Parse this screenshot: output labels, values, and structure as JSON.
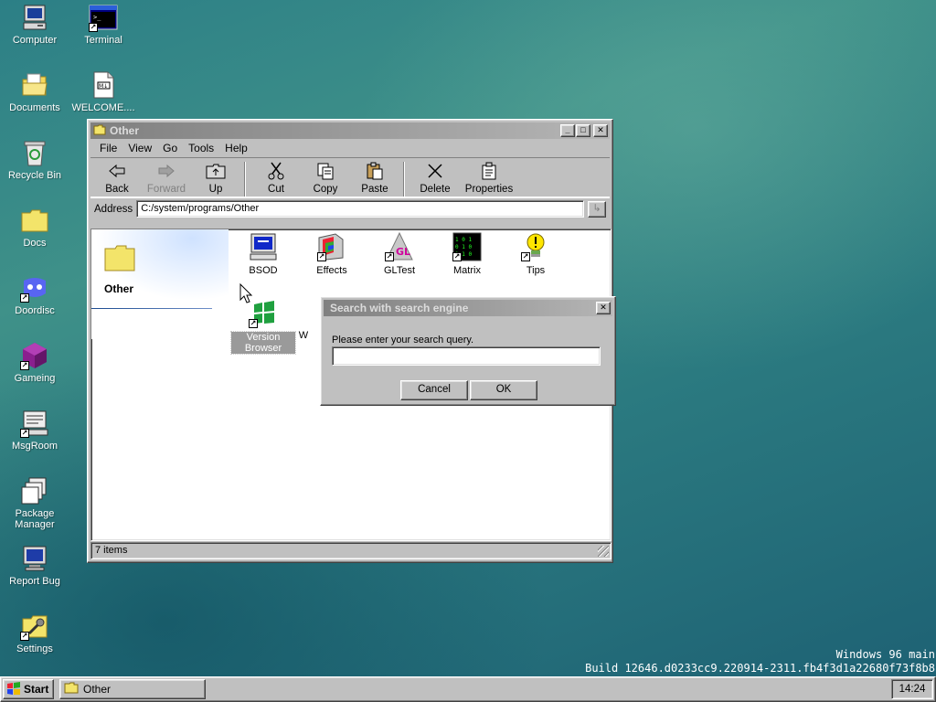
{
  "desktop_icons": [
    {
      "label": "Computer",
      "icon": "computer-icon"
    },
    {
      "label": "Terminal",
      "icon": "terminal-icon"
    },
    {
      "label": "Documents",
      "icon": "documents-folder-icon"
    },
    {
      "label": "WELCOME....",
      "icon": "text-file-icon"
    },
    {
      "label": "Recycle Bin",
      "icon": "recycle-bin-icon"
    },
    {
      "label": "Docs",
      "icon": "folder-icon"
    },
    {
      "label": "Doordisc",
      "icon": "doordisc-icon"
    },
    {
      "label": "Gameing",
      "icon": "game-cube-icon"
    },
    {
      "label": "MsgRoom",
      "icon": "msgroom-icon"
    },
    {
      "label": "Package Manager",
      "icon": "package-icon"
    },
    {
      "label": "Report Bug",
      "icon": "bug-monitor-icon"
    },
    {
      "label": "Settings",
      "icon": "settings-icon"
    }
  ],
  "window": {
    "title": "Other",
    "menu": [
      "File",
      "View",
      "Go",
      "Tools",
      "Help"
    ],
    "toolbar": {
      "back": "Back",
      "forward": "Forward",
      "up": "Up",
      "cut": "Cut",
      "copy": "Copy",
      "paste": "Paste",
      "delete": "Delete",
      "properties": "Properties"
    },
    "address_label": "Address",
    "address_value": "C:/system/programs/Other",
    "panel_title": "Other",
    "files": [
      {
        "label": "BSOD",
        "icon": "bsod-monitor-icon"
      },
      {
        "label": "Effects",
        "icon": "effects-icon"
      },
      {
        "label": "GLTest",
        "icon": "gl-cone-icon"
      },
      {
        "label": "Matrix",
        "icon": "matrix-icon"
      },
      {
        "label": "Tips",
        "icon": "tips-bulb-icon"
      },
      {
        "label": "Version Browser",
        "icon": "windows-flag-icon"
      }
    ],
    "partial_file_label": "W",
    "status": "7 items"
  },
  "dialog": {
    "title": "Search with search engine",
    "prompt": "Please enter your search query.",
    "input_value": "",
    "cancel_label": "Cancel",
    "ok_label": "OK"
  },
  "taskbar": {
    "start_label": "Start",
    "task_label": "Other",
    "clock": "14:24"
  },
  "build": {
    "line1": "Windows 96 main",
    "line2": "Build 12646.d0233cc9.220914-2311.fb4f3d1a22680f73f8b8"
  },
  "colors": {
    "desktop": "#2f8486",
    "window_face": "#c0c0c0",
    "inactive_title": "#808080"
  }
}
